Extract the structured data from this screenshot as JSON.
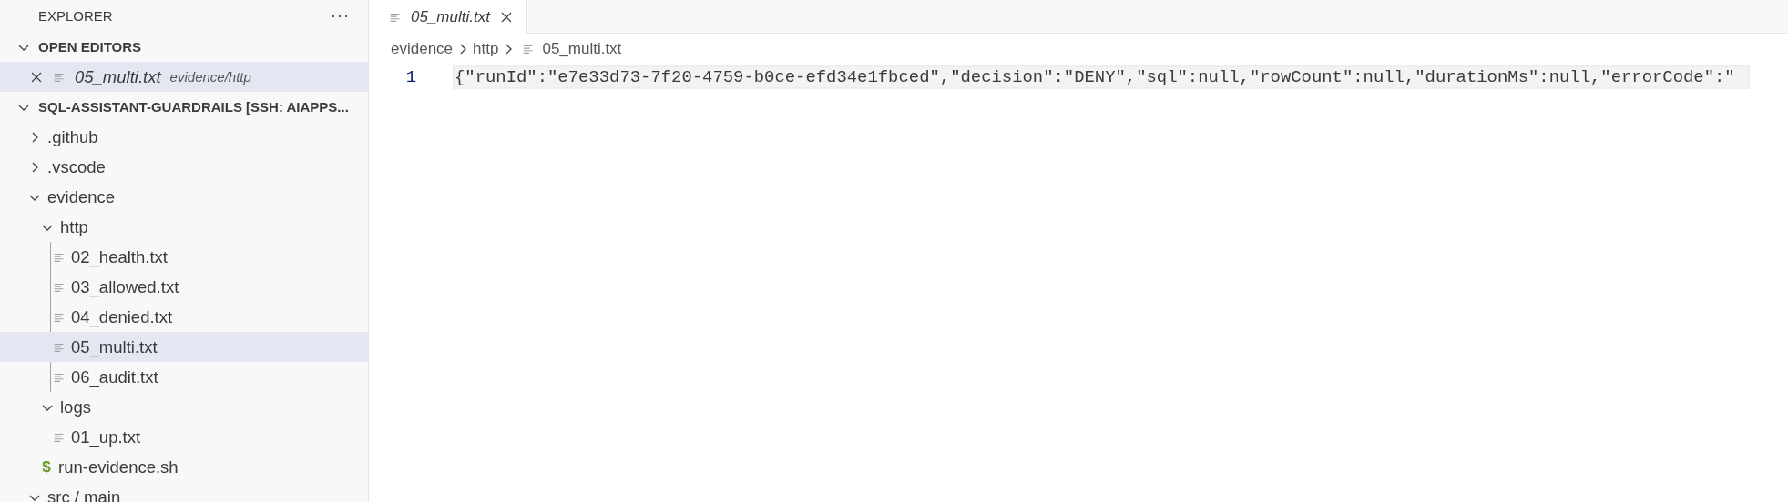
{
  "sidebar": {
    "title": "EXPLORER",
    "more": "···",
    "open_editors": {
      "title": "OPEN EDITORS",
      "expanded": true,
      "items": [
        {
          "name": "05_multi.txt",
          "path": "evidence/http",
          "selected": true
        }
      ]
    },
    "workspace": {
      "title": "SQL-ASSISTANT-GUARDRAILS [SSH: AIAPPS...",
      "expanded": true,
      "tree": [
        {
          "kind": "folder",
          "name": ".github",
          "expanded": false,
          "selected": false
        },
        {
          "kind": "folder",
          "name": ".vscode",
          "expanded": false,
          "selected": false
        },
        {
          "kind": "folder",
          "name": "evidence",
          "expanded": true,
          "selected": false,
          "children": [
            {
              "kind": "folder",
              "name": "http",
              "expanded": true,
              "selected": false,
              "children": [
                {
                  "kind": "text",
                  "name": "02_health.txt",
                  "selected": false
                },
                {
                  "kind": "text",
                  "name": "03_allowed.txt",
                  "selected": false
                },
                {
                  "kind": "text",
                  "name": "04_denied.txt",
                  "selected": false
                },
                {
                  "kind": "text",
                  "name": "05_multi.txt",
                  "selected": true
                },
                {
                  "kind": "text",
                  "name": "06_audit.txt",
                  "selected": false
                }
              ]
            },
            {
              "kind": "folder",
              "name": "logs",
              "expanded": true,
              "selected": false,
              "children": [
                {
                  "kind": "text",
                  "name": "01_up.txt",
                  "selected": false
                }
              ]
            },
            {
              "kind": "shell",
              "icon": "$",
              "name": "run-evidence.sh",
              "selected": false
            }
          ]
        },
        {
          "kind": "folder",
          "name": "src / main",
          "expanded": true,
          "selected": false
        }
      ]
    }
  },
  "editor": {
    "tabs": [
      {
        "label": "05_multi.txt",
        "preview": true,
        "selected": true
      }
    ],
    "breadcrumb": [
      {
        "label": "evidence",
        "kind": "folder"
      },
      {
        "label": "http",
        "kind": "folder"
      },
      {
        "label": "05_multi.txt",
        "kind": "text"
      }
    ],
    "lines": [
      {
        "number": "1",
        "text": "{\"runId\":\"e7e33d73-7f20-4759-b0ce-efd34e1fbced\",\"decision\":\"DENY\",\"sql\":null,\"rowCount\":null,\"durationMs\":null,\"errorCode\":\"",
        "current": true
      }
    ]
  }
}
